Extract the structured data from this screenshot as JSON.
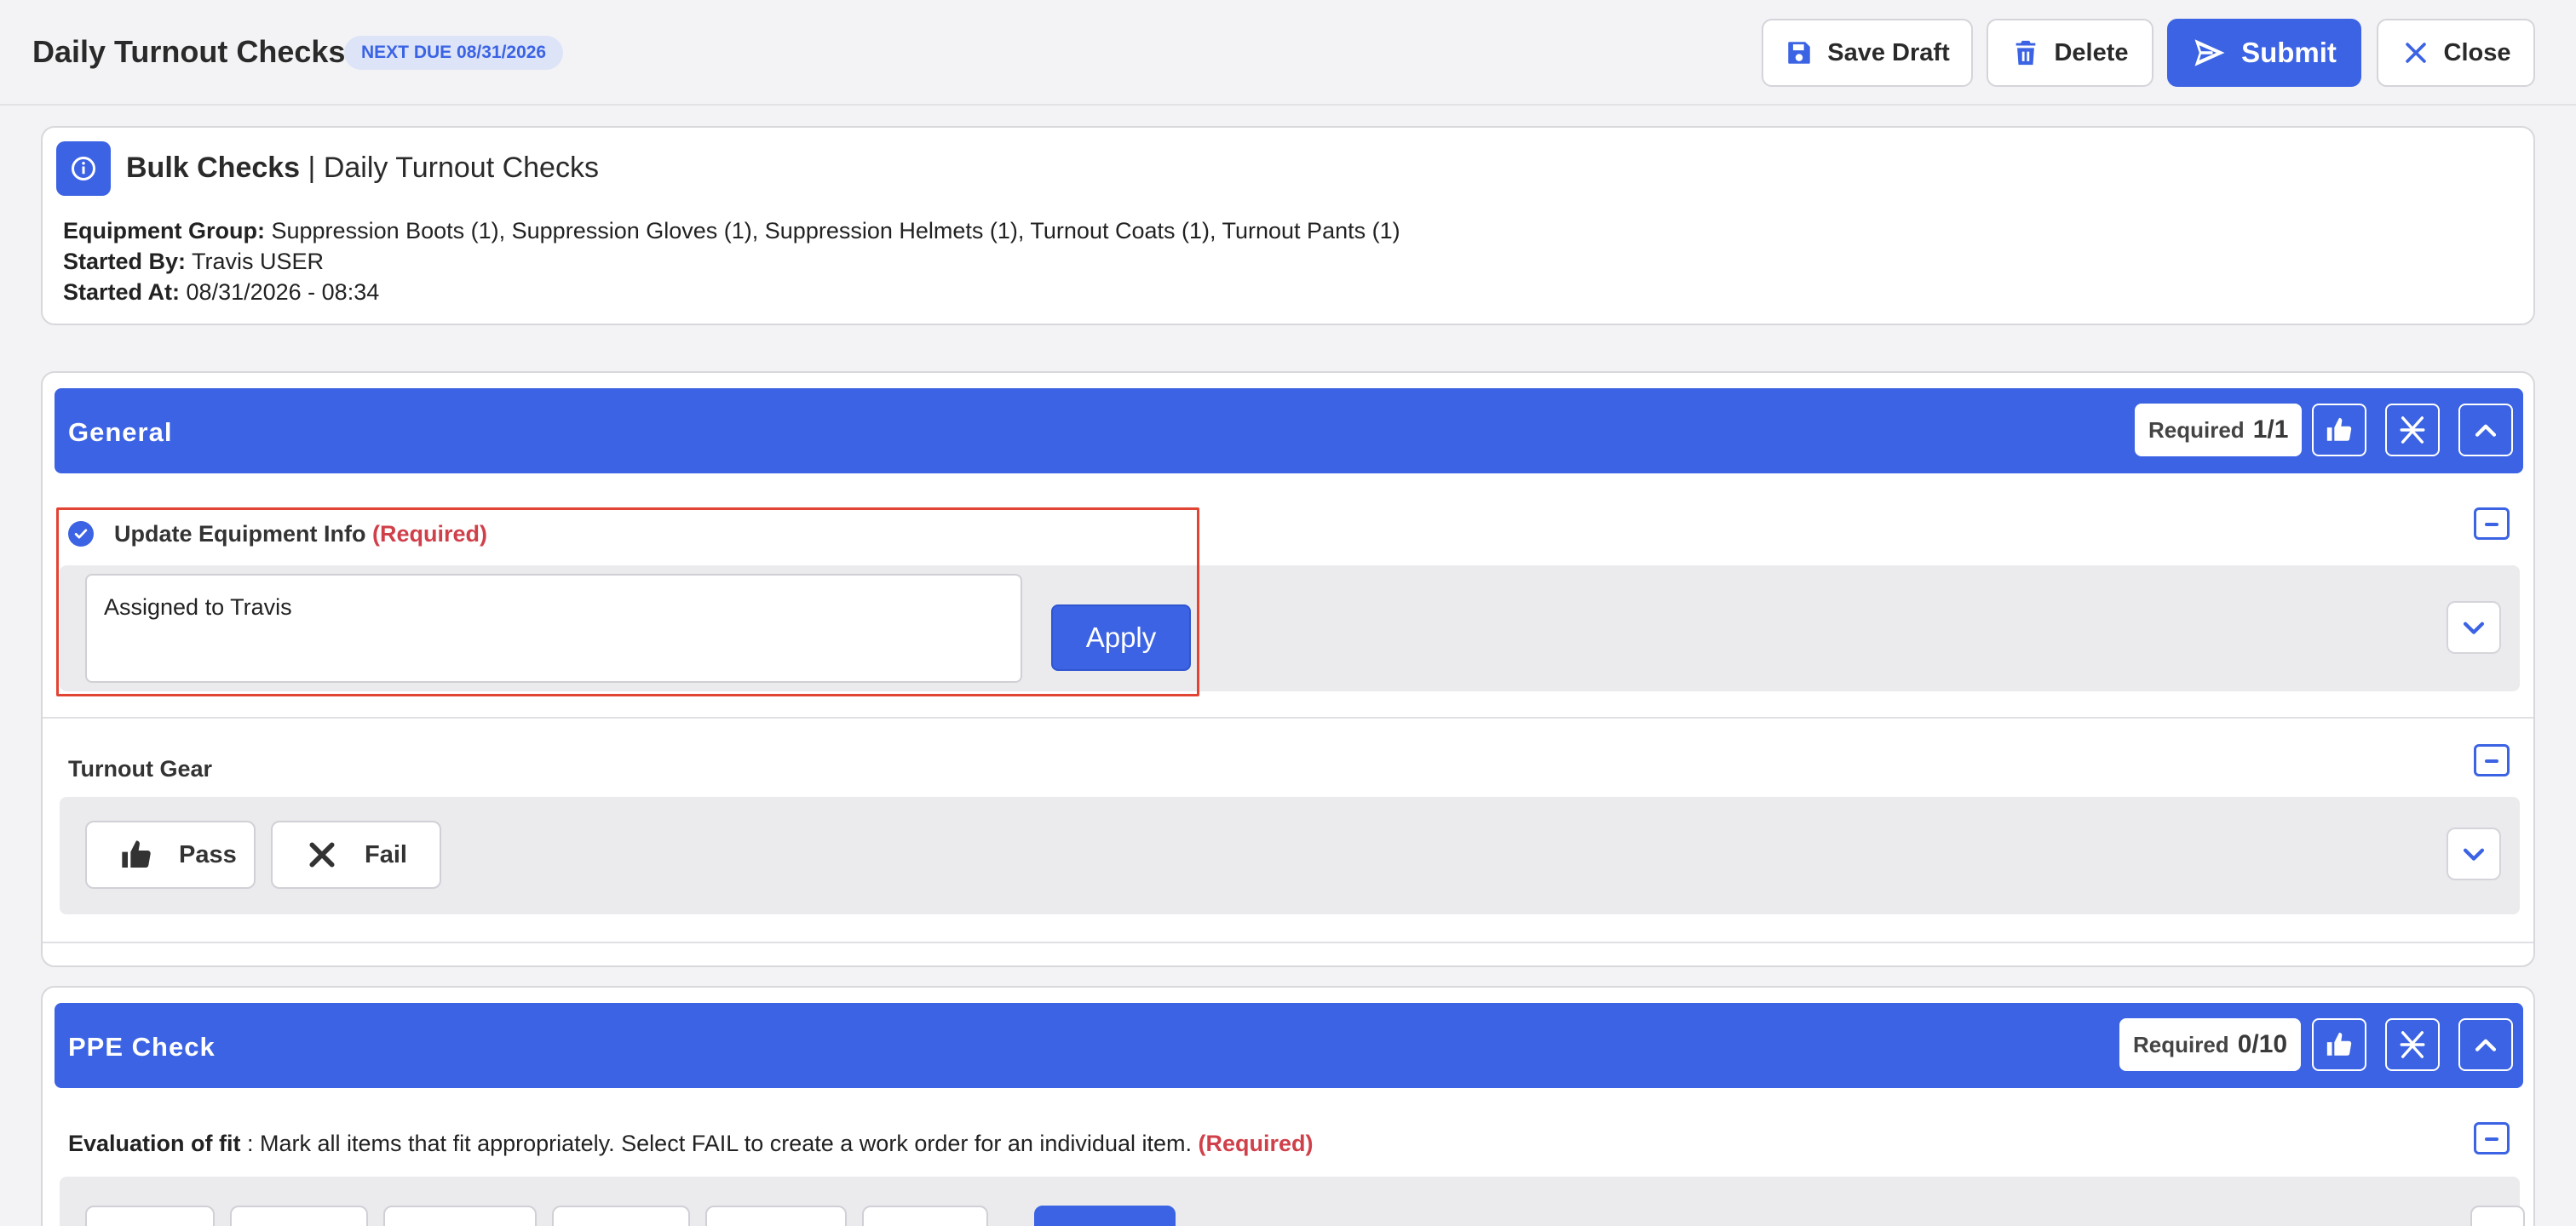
{
  "header": {
    "title": "Daily Turnout Checks",
    "due_badge": "NEXT DUE 08/31/2026",
    "save_draft": "Save Draft",
    "delete": "Delete",
    "submit": "Submit",
    "close": "Close"
  },
  "info": {
    "title_bold": "Bulk Checks",
    "title_rest": "| Daily Turnout Checks",
    "equipment_group_label": "Equipment Group:",
    "equipment_group_value": "Suppression Boots (1), Suppression Gloves (1), Suppression Helmets (1), Turnout Coats (1), Turnout Pants (1)",
    "started_by_label": "Started By:",
    "started_by_value": "Travis USER",
    "started_at_label": "Started At:",
    "started_at_value": "08/31/2026 - 08:34"
  },
  "general": {
    "title": "General",
    "required_label": "Required",
    "required_count": "1/1",
    "update_item": {
      "label": "Update Equipment Info",
      "required_tag": "(Required)",
      "textarea_value": "Assigned to Travis",
      "apply": "Apply"
    },
    "turnout_item": {
      "label": "Turnout Gear",
      "pass": "Pass",
      "fail": "Fail"
    }
  },
  "ppe": {
    "title": "PPE Check",
    "required_label": "Required",
    "required_count": "0/10",
    "eval_label": "Evaluation of fit",
    "eval_text": " : Mark all items that fit appropriately. Select FAIL to create a work order for an individual item. ",
    "eval_required": "(Required)"
  },
  "colors": {
    "accent": "#3b63e3",
    "required": "#d0404a",
    "highlight": "#e24434"
  }
}
